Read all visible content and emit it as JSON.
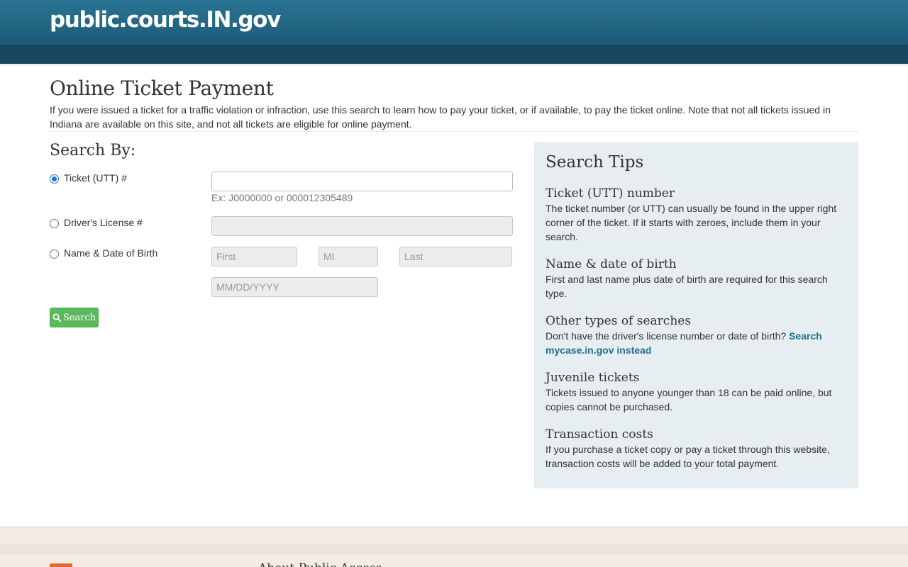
{
  "header": {
    "brand": "public.courts.IN.gov"
  },
  "main": {
    "title": "Online Ticket Payment",
    "intro": "If you were issued a ticket for a traffic violation or infraction, use this search to learn how to pay your ticket, or if available, to pay the ticket online. Note that not all tickets issued in Indiana are available on this site, and not all tickets are eligible for online payment."
  },
  "search": {
    "heading": "Search By:",
    "options": [
      {
        "label": "Ticket (UTT) #",
        "selected": true
      },
      {
        "label": "Driver's License #",
        "selected": false
      },
      {
        "label": "Name & Date of Birth",
        "selected": false
      }
    ],
    "ticket_hint": "Ex: J0000000 or 000012305489",
    "placeholders": {
      "first": "First",
      "mi": "MI",
      "last": "Last",
      "dob": "MM/DD/YYYY"
    },
    "button_label": "Search",
    "button_icon": "search-icon"
  },
  "tips": {
    "title": "Search Tips",
    "items": [
      {
        "heading": "Ticket (UTT) number",
        "text": "The ticket number (or UTT) can usually be found in the upper right corner of the ticket. If it starts with zeroes, include them in your search."
      },
      {
        "heading": "Name & date of birth",
        "text": "First and last name plus date of birth are required for this search type."
      },
      {
        "heading": "Other types of searches",
        "text": "Don't have the driver's license number or date of birth?",
        "link": "Search mycase.in.gov instead"
      },
      {
        "heading": "Juvenile tickets",
        "text": "Tickets issued to anyone younger than 18 can be paid online, but copies cannot be purchased."
      },
      {
        "heading": "Transaction costs",
        "text": "If you purchase a ticket copy or pay a ticket through this website, transaction costs will be added to your total payment."
      }
    ]
  },
  "footer": {
    "heading": "About Public Access"
  },
  "colors": {
    "header": "#1f6584",
    "navbar": "#16475e",
    "accent_link": "#1f6e8c",
    "button": "#5cb85c",
    "tips_bg": "#e6eef1",
    "footer_bg": "#f3ece3"
  }
}
